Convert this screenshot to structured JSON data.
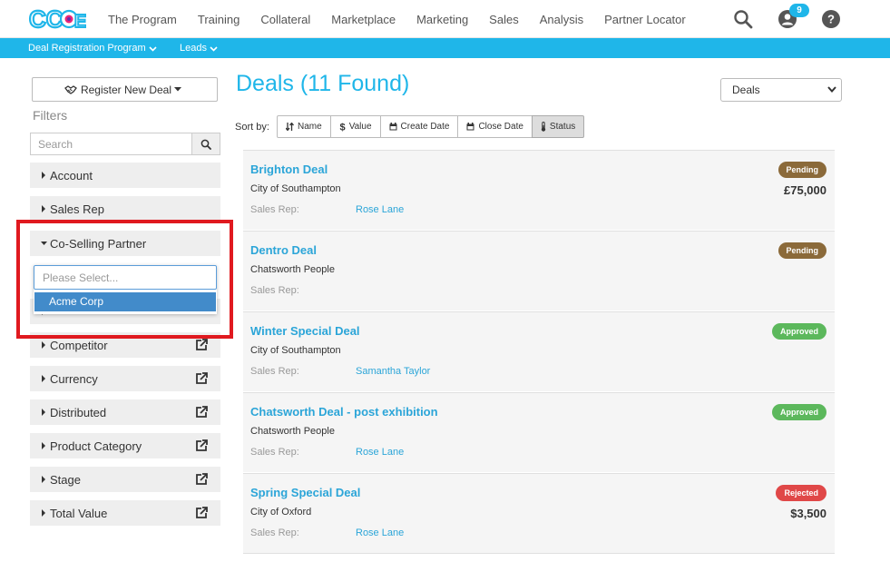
{
  "topnav": {
    "links": [
      "The Program",
      "Training",
      "Collateral",
      "Marketplace",
      "Marketing",
      "Sales",
      "Analysis",
      "Partner Locator"
    ],
    "notification_count": "9"
  },
  "subnav": {
    "items": [
      "Deal Registration Program",
      "Leads"
    ]
  },
  "sidebar": {
    "register_label": "Register New Deal",
    "filters_title": "Filters",
    "search_placeholder": "Search",
    "filters": [
      "Account",
      "Sales Rep",
      "Co-Selling Partner",
      "Competitor",
      "Currency",
      "Distributed",
      "Product Category",
      "Stage",
      "Total Value"
    ],
    "dropdown": {
      "placeholder": "Please Select...",
      "option": "Acme Corp"
    }
  },
  "main": {
    "title": "Deals (11 Found)",
    "view_select": "Deals",
    "sort_label": "Sort by:",
    "sort_buttons": [
      "Name",
      "Value",
      "Create Date",
      "Close Date",
      "Status"
    ],
    "rep_label": "Sales Rep:",
    "deals": [
      {
        "name": "Brighton Deal",
        "account": "City of Southampton",
        "rep": "Rose Lane",
        "status": "Pending",
        "value": "£75,000"
      },
      {
        "name": "Dentro Deal",
        "account": "Chatsworth People",
        "rep": "",
        "status": "Pending",
        "value": ""
      },
      {
        "name": "Winter Special Deal",
        "account": "City of Southampton",
        "rep": "Samantha Taylor",
        "status": "Approved",
        "value": ""
      },
      {
        "name": "Chatsworth Deal - post exhibition",
        "account": "Chatsworth People",
        "rep": "Rose Lane",
        "status": "Approved",
        "value": ""
      },
      {
        "name": "Spring Special Deal",
        "account": "City of Oxford",
        "rep": "Rose Lane",
        "status": "Rejected",
        "value": "$3,500"
      }
    ]
  },
  "colors": {
    "accent": "#1fb6e9",
    "pending": "#8b6a3a",
    "approved": "#5cb85c",
    "rejected": "#e04848"
  }
}
